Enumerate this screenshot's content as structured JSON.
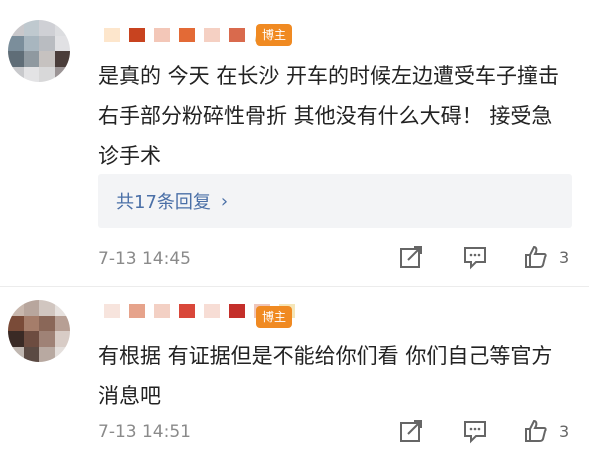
{
  "comments": [
    {
      "badge": "博主",
      "text": "是真的 今天 在长沙 开车的时候左边遭受车子撞击 右手部分粉碎性骨折 其他没有什么大碍！ 接受急诊手术",
      "replies_label": "共17条回复",
      "time": "7-13 14:45",
      "likes": "3"
    },
    {
      "badge": "博主",
      "text": "有根据 有证据但是不能给你们看 你们自己等官方消息吧",
      "time": "7-13 14:51",
      "likes": "3"
    }
  ],
  "icons": {
    "share": "share-icon",
    "comment": "comment-icon",
    "like": "like-icon",
    "crown": "crown-icon",
    "chevron": "chevron-right-icon"
  },
  "colors": {
    "badge": "#f08a22",
    "reply_link": "#4a6fa7",
    "reply_bg": "#f3f4f6"
  }
}
